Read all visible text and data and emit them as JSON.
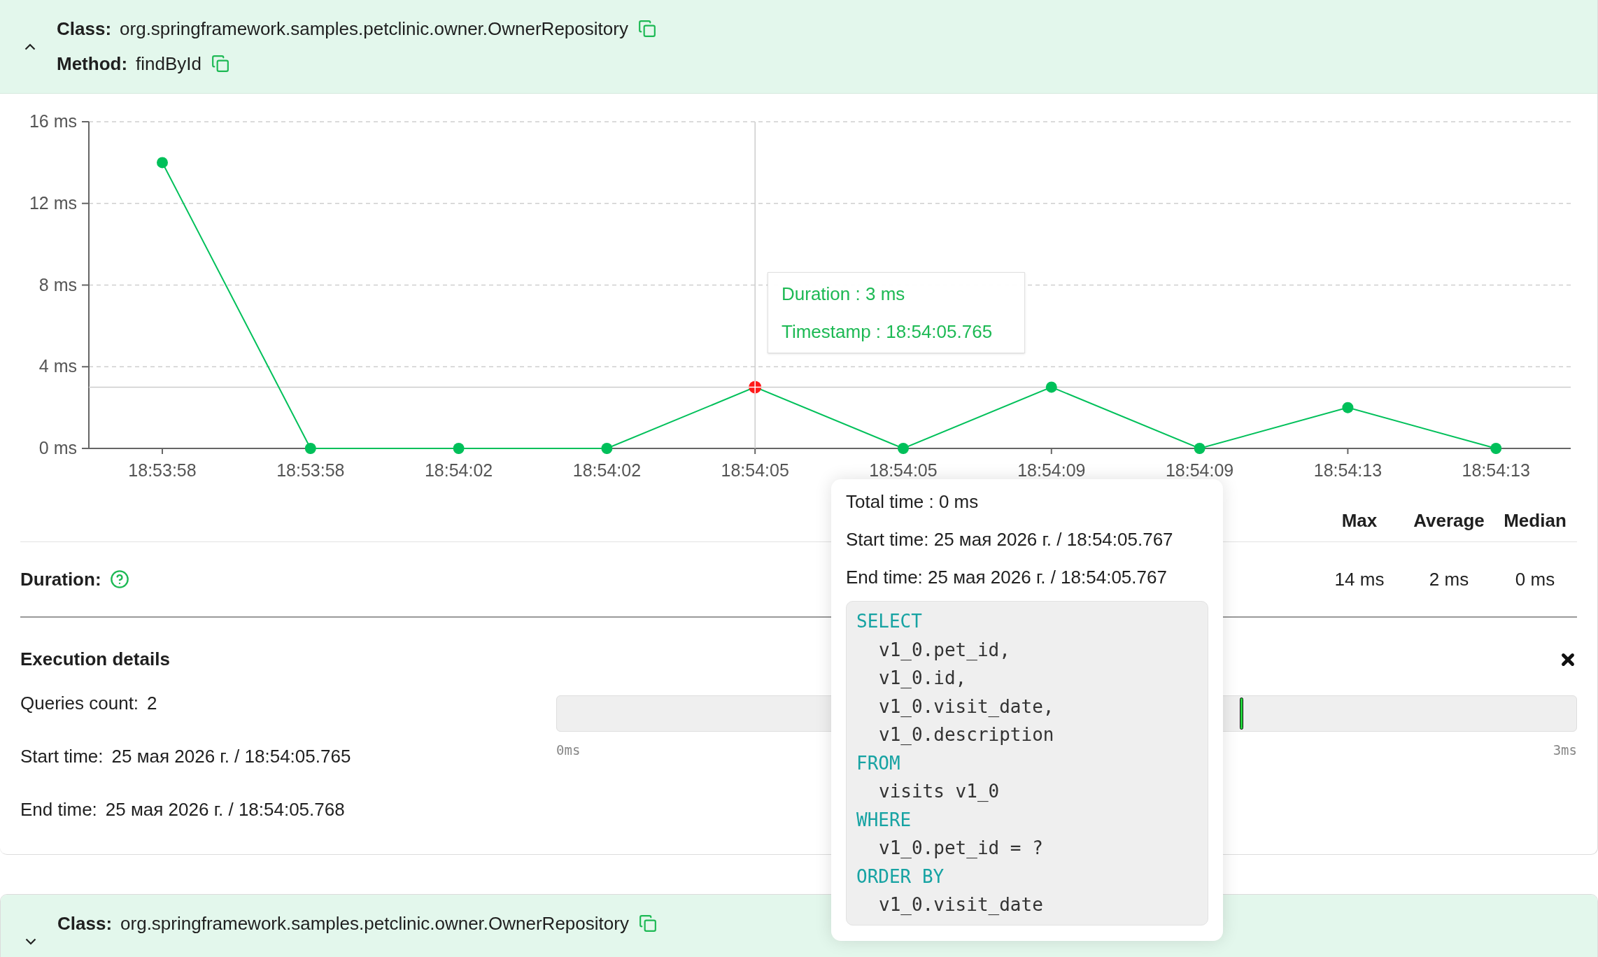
{
  "cards": [
    {
      "expanded": true,
      "class_label": "Class:",
      "class_value": "org.springframework.samples.petclinic.owner.OwnerRepository",
      "method_label": "Method:",
      "method_value": "findById"
    },
    {
      "expanded": false,
      "class_label": "Class:",
      "class_value": "org.springframework.samples.petclinic.owner.OwnerRepository"
    }
  ],
  "chart": {
    "chart_data": {
      "type": "line",
      "categories": [
        "18:53:58",
        "18:53:58",
        "18:54:02",
        "18:54:02",
        "18:54:05",
        "18:54:05",
        "18:54:09",
        "18:54:09",
        "18:54:13",
        "18:54:13"
      ],
      "series": [
        {
          "color": "#00c05a",
          "marker": "o",
          "values": [
            14,
            0,
            0,
            0,
            3,
            0,
            3,
            0,
            2,
            0
          ]
        }
      ],
      "grid": true,
      "ref_lines": [
        {
          "axis": "x",
          "value": "18:54:05"
        },
        {
          "axis": "y",
          "value": 3
        }
      ],
      "ylim": [
        0,
        16
      ],
      "yticks": [
        {
          "value": 0,
          "label": "0 ms"
        },
        {
          "value": 4,
          "label": "4 ms"
        },
        {
          "value": 8,
          "label": "8 ms"
        },
        {
          "value": 12,
          "label": "12 ms"
        },
        {
          "value": 16,
          "label": "16 ms"
        }
      ]
    },
    "points": [
      {
        "selected": false
      },
      {
        "selected": false
      },
      {
        "selected": false
      },
      {
        "selected": false
      },
      {
        "selected": true
      },
      {
        "selected": false
      },
      {
        "selected": false
      },
      {
        "selected": false
      },
      {
        "selected": false
      },
      {
        "selected": false
      }
    ],
    "tooltip": [
      "Duration : 3 ms",
      "Timestamp : 18:54:05.765"
    ]
  },
  "stats": {
    "label": "Duration:",
    "columns": [
      "Max",
      "Average",
      "Median"
    ],
    "values": [
      "14 ms",
      "2 ms",
      "0 ms"
    ]
  },
  "execution": {
    "title": "Execution details",
    "rows": [
      {
        "label": "Queries count:",
        "value": "2"
      },
      {
        "label": "Start time:",
        "value": "25 мая 2026 г. / 18:54:05.765"
      },
      {
        "label": "End time:",
        "value": "25 мая 2026 г. / 18:54:05.768"
      }
    ],
    "timeline": {
      "start_label": "0ms",
      "end_label": "3ms",
      "markers": [
        {
          "level": 0.67
        }
      ]
    }
  },
  "popup": {
    "lines": [
      "Total time : 0 ms",
      "Start time: 25 мая 2026 г. / 18:54:05.767",
      "End time: 25 мая 2026 г. / 18:54:05.767"
    ],
    "sql": [
      {
        "kind": "keyword",
        "text": "SELECT"
      },
      {
        "kind": "text",
        "text": "v1_0.pet_id,"
      },
      {
        "kind": "text",
        "text": "v1_0.id,"
      },
      {
        "kind": "text",
        "text": "v1_0.visit_date,"
      },
      {
        "kind": "text",
        "text": "v1_0.description"
      },
      {
        "kind": "keyword",
        "text": "FROM"
      },
      {
        "kind": "text",
        "text": "visits v1_0"
      },
      {
        "kind": "keyword",
        "text": "WHERE"
      },
      {
        "kind": "text",
        "text": "v1_0.pet_id = ?"
      },
      {
        "kind": "keyword",
        "text": "ORDER BY"
      },
      {
        "kind": "text",
        "text": "v1_0.visit_date"
      }
    ]
  }
}
